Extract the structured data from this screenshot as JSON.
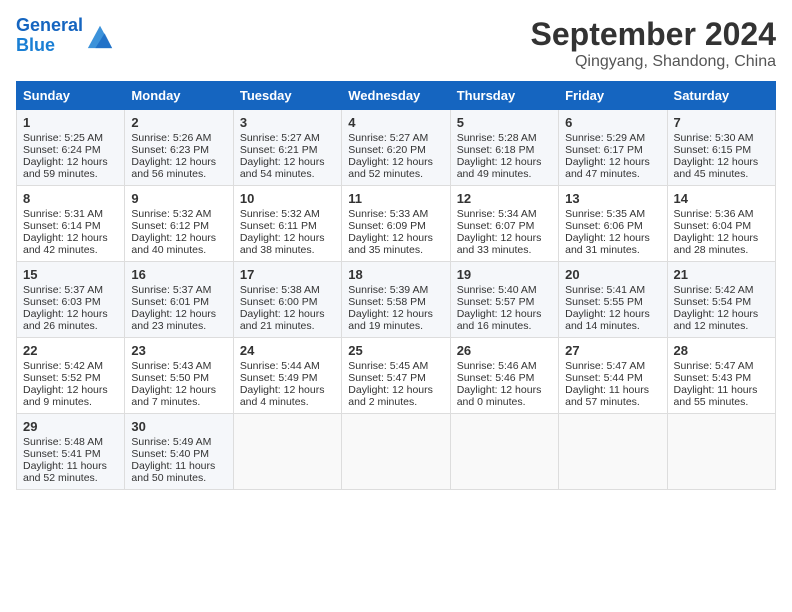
{
  "header": {
    "logo_line1": "General",
    "logo_line2": "Blue",
    "month_year": "September 2024",
    "location": "Qingyang, Shandong, China"
  },
  "weekdays": [
    "Sunday",
    "Monday",
    "Tuesday",
    "Wednesday",
    "Thursday",
    "Friday",
    "Saturday"
  ],
  "weeks": [
    [
      {
        "day": "1",
        "lines": [
          "Sunrise: 5:25 AM",
          "Sunset: 6:24 PM",
          "Daylight: 12 hours",
          "and 59 minutes."
        ]
      },
      {
        "day": "2",
        "lines": [
          "Sunrise: 5:26 AM",
          "Sunset: 6:23 PM",
          "Daylight: 12 hours",
          "and 56 minutes."
        ]
      },
      {
        "day": "3",
        "lines": [
          "Sunrise: 5:27 AM",
          "Sunset: 6:21 PM",
          "Daylight: 12 hours",
          "and 54 minutes."
        ]
      },
      {
        "day": "4",
        "lines": [
          "Sunrise: 5:27 AM",
          "Sunset: 6:20 PM",
          "Daylight: 12 hours",
          "and 52 minutes."
        ]
      },
      {
        "day": "5",
        "lines": [
          "Sunrise: 5:28 AM",
          "Sunset: 6:18 PM",
          "Daylight: 12 hours",
          "and 49 minutes."
        ]
      },
      {
        "day": "6",
        "lines": [
          "Sunrise: 5:29 AM",
          "Sunset: 6:17 PM",
          "Daylight: 12 hours",
          "and 47 minutes."
        ]
      },
      {
        "day": "7",
        "lines": [
          "Sunrise: 5:30 AM",
          "Sunset: 6:15 PM",
          "Daylight: 12 hours",
          "and 45 minutes."
        ]
      }
    ],
    [
      {
        "day": "8",
        "lines": [
          "Sunrise: 5:31 AM",
          "Sunset: 6:14 PM",
          "Daylight: 12 hours",
          "and 42 minutes."
        ]
      },
      {
        "day": "9",
        "lines": [
          "Sunrise: 5:32 AM",
          "Sunset: 6:12 PM",
          "Daylight: 12 hours",
          "and 40 minutes."
        ]
      },
      {
        "day": "10",
        "lines": [
          "Sunrise: 5:32 AM",
          "Sunset: 6:11 PM",
          "Daylight: 12 hours",
          "and 38 minutes."
        ]
      },
      {
        "day": "11",
        "lines": [
          "Sunrise: 5:33 AM",
          "Sunset: 6:09 PM",
          "Daylight: 12 hours",
          "and 35 minutes."
        ]
      },
      {
        "day": "12",
        "lines": [
          "Sunrise: 5:34 AM",
          "Sunset: 6:07 PM",
          "Daylight: 12 hours",
          "and 33 minutes."
        ]
      },
      {
        "day": "13",
        "lines": [
          "Sunrise: 5:35 AM",
          "Sunset: 6:06 PM",
          "Daylight: 12 hours",
          "and 31 minutes."
        ]
      },
      {
        "day": "14",
        "lines": [
          "Sunrise: 5:36 AM",
          "Sunset: 6:04 PM",
          "Daylight: 12 hours",
          "and 28 minutes."
        ]
      }
    ],
    [
      {
        "day": "15",
        "lines": [
          "Sunrise: 5:37 AM",
          "Sunset: 6:03 PM",
          "Daylight: 12 hours",
          "and 26 minutes."
        ]
      },
      {
        "day": "16",
        "lines": [
          "Sunrise: 5:37 AM",
          "Sunset: 6:01 PM",
          "Daylight: 12 hours",
          "and 23 minutes."
        ]
      },
      {
        "day": "17",
        "lines": [
          "Sunrise: 5:38 AM",
          "Sunset: 6:00 PM",
          "Daylight: 12 hours",
          "and 21 minutes."
        ]
      },
      {
        "day": "18",
        "lines": [
          "Sunrise: 5:39 AM",
          "Sunset: 5:58 PM",
          "Daylight: 12 hours",
          "and 19 minutes."
        ]
      },
      {
        "day": "19",
        "lines": [
          "Sunrise: 5:40 AM",
          "Sunset: 5:57 PM",
          "Daylight: 12 hours",
          "and 16 minutes."
        ]
      },
      {
        "day": "20",
        "lines": [
          "Sunrise: 5:41 AM",
          "Sunset: 5:55 PM",
          "Daylight: 12 hours",
          "and 14 minutes."
        ]
      },
      {
        "day": "21",
        "lines": [
          "Sunrise: 5:42 AM",
          "Sunset: 5:54 PM",
          "Daylight: 12 hours",
          "and 12 minutes."
        ]
      }
    ],
    [
      {
        "day": "22",
        "lines": [
          "Sunrise: 5:42 AM",
          "Sunset: 5:52 PM",
          "Daylight: 12 hours",
          "and 9 minutes."
        ]
      },
      {
        "day": "23",
        "lines": [
          "Sunrise: 5:43 AM",
          "Sunset: 5:50 PM",
          "Daylight: 12 hours",
          "and 7 minutes."
        ]
      },
      {
        "day": "24",
        "lines": [
          "Sunrise: 5:44 AM",
          "Sunset: 5:49 PM",
          "Daylight: 12 hours",
          "and 4 minutes."
        ]
      },
      {
        "day": "25",
        "lines": [
          "Sunrise: 5:45 AM",
          "Sunset: 5:47 PM",
          "Daylight: 12 hours",
          "and 2 minutes."
        ]
      },
      {
        "day": "26",
        "lines": [
          "Sunrise: 5:46 AM",
          "Sunset: 5:46 PM",
          "Daylight: 12 hours",
          "and 0 minutes."
        ]
      },
      {
        "day": "27",
        "lines": [
          "Sunrise: 5:47 AM",
          "Sunset: 5:44 PM",
          "Daylight: 11 hours",
          "and 57 minutes."
        ]
      },
      {
        "day": "28",
        "lines": [
          "Sunrise: 5:47 AM",
          "Sunset: 5:43 PM",
          "Daylight: 11 hours",
          "and 55 minutes."
        ]
      }
    ],
    [
      {
        "day": "29",
        "lines": [
          "Sunrise: 5:48 AM",
          "Sunset: 5:41 PM",
          "Daylight: 11 hours",
          "and 52 minutes."
        ]
      },
      {
        "day": "30",
        "lines": [
          "Sunrise: 5:49 AM",
          "Sunset: 5:40 PM",
          "Daylight: 11 hours",
          "and 50 minutes."
        ]
      },
      {
        "day": "",
        "lines": []
      },
      {
        "day": "",
        "lines": []
      },
      {
        "day": "",
        "lines": []
      },
      {
        "day": "",
        "lines": []
      },
      {
        "day": "",
        "lines": []
      }
    ]
  ]
}
